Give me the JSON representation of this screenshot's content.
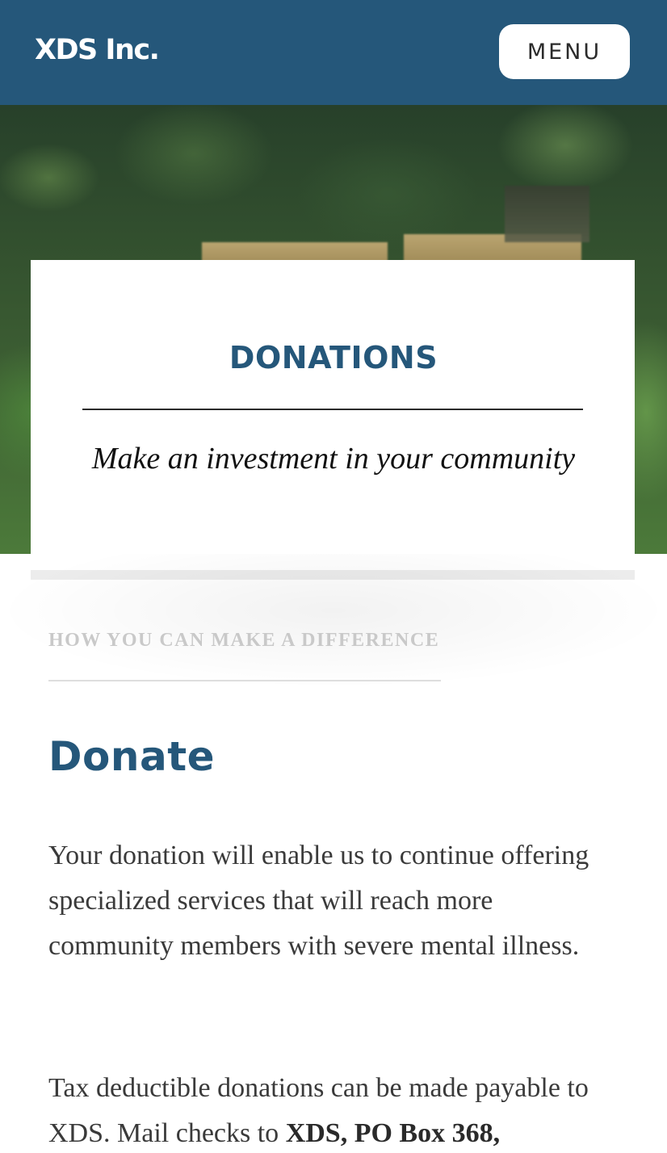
{
  "colors": {
    "brand": "#25577a",
    "text": "#3a3a3a"
  },
  "header": {
    "logo": "XDS Inc.",
    "menu_label": "MENU"
  },
  "hero": {
    "image": "blurred-garden-beehives-photo"
  },
  "card": {
    "title": "DONATIONS",
    "subtitle": "Make an investment in your community"
  },
  "section": {
    "label": "HOW YOU CAN MAKE A DIFFERENCE"
  },
  "main": {
    "heading": "Donate",
    "paragraph1": "Your donation will enable us to continue offering specialized services that will reach more community members with severe mental illness.",
    "paragraph2_text": "Tax deductible donations can be made payable to XDS. Mail checks to ",
    "paragraph2_bold": "XDS, PO Box 368,"
  }
}
